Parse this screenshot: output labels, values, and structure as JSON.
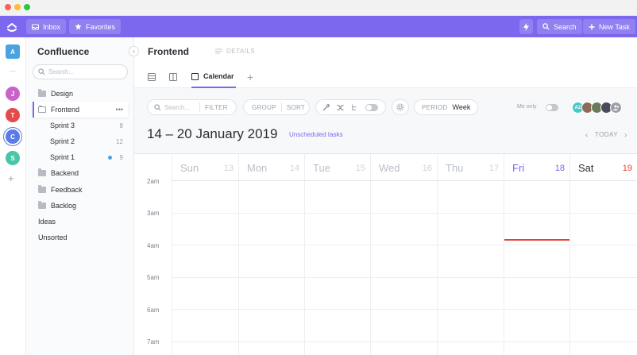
{
  "topbar": {
    "inbox": "Inbox",
    "favorites": "Favorites",
    "search": "Search",
    "new_task": "New Task",
    "bg_color": "#7b68ee"
  },
  "rail": {
    "workspace": "A",
    "users": [
      {
        "initial": "J",
        "color": "#c864c8"
      },
      {
        "initial": "T",
        "color": "#e44c4c"
      },
      {
        "initial": "C",
        "color": "#5b7be8"
      },
      {
        "initial": "S",
        "color": "#49c6a5"
      }
    ],
    "add": "+"
  },
  "sidebar": {
    "title": "Confluence",
    "search_placeholder": "Search...",
    "items": [
      {
        "label": "Design",
        "type": "folder"
      },
      {
        "label": "Frontend",
        "type": "folder-open",
        "more": "•••"
      },
      {
        "label": "Sprint 3",
        "type": "list",
        "count": "8"
      },
      {
        "label": "Sprint 2",
        "type": "list",
        "count": "12"
      },
      {
        "label": "Sprint 1",
        "type": "list",
        "count": "9"
      },
      {
        "label": "Backend",
        "type": "folder"
      },
      {
        "label": "Feedback",
        "type": "folder"
      },
      {
        "label": "Backlog",
        "type": "folder"
      },
      {
        "label": "Ideas",
        "type": "plain"
      },
      {
        "label": "Unsorted",
        "type": "plain"
      }
    ]
  },
  "header": {
    "title": "Frontend",
    "details": "DETAILS",
    "active_view": "Calendar",
    "add": "+"
  },
  "toolbar": {
    "search_placeholder": "Search...",
    "filter": "FILTER",
    "group": "GROUP",
    "sort": "SORT",
    "period_label": "PERIOD",
    "period_value": "Week",
    "me_only": "Me only",
    "assignees": [
      {
        "initials": "AZ",
        "color": "#49c6c6"
      },
      {
        "initials": "",
        "color": "#8a6a5a"
      },
      {
        "initials": "",
        "color": "#6b7b5a"
      },
      {
        "initials": "",
        "color": "#4a4a5a"
      },
      {
        "initials": "",
        "color": "#9aa0aa"
      }
    ]
  },
  "calendar": {
    "range": "14 – 20 January 2019",
    "unscheduled": "Unscheduled tasks",
    "today": "TODAY",
    "prev": "‹",
    "next": "›",
    "days": [
      {
        "name": "Sun",
        "num": "13"
      },
      {
        "name": "Mon",
        "num": "14"
      },
      {
        "name": "Tue",
        "num": "15"
      },
      {
        "name": "Wed",
        "num": "16"
      },
      {
        "name": "Thu",
        "num": "17"
      },
      {
        "name": "Fri",
        "num": "18"
      },
      {
        "name": "Sat",
        "num": "19"
      }
    ],
    "times": [
      "2am",
      "3am",
      "4am",
      "5am",
      "6am",
      "7am"
    ],
    "today_color": "#7b68ee",
    "weekend_color": "#e44332",
    "now_color": "#e44332"
  }
}
